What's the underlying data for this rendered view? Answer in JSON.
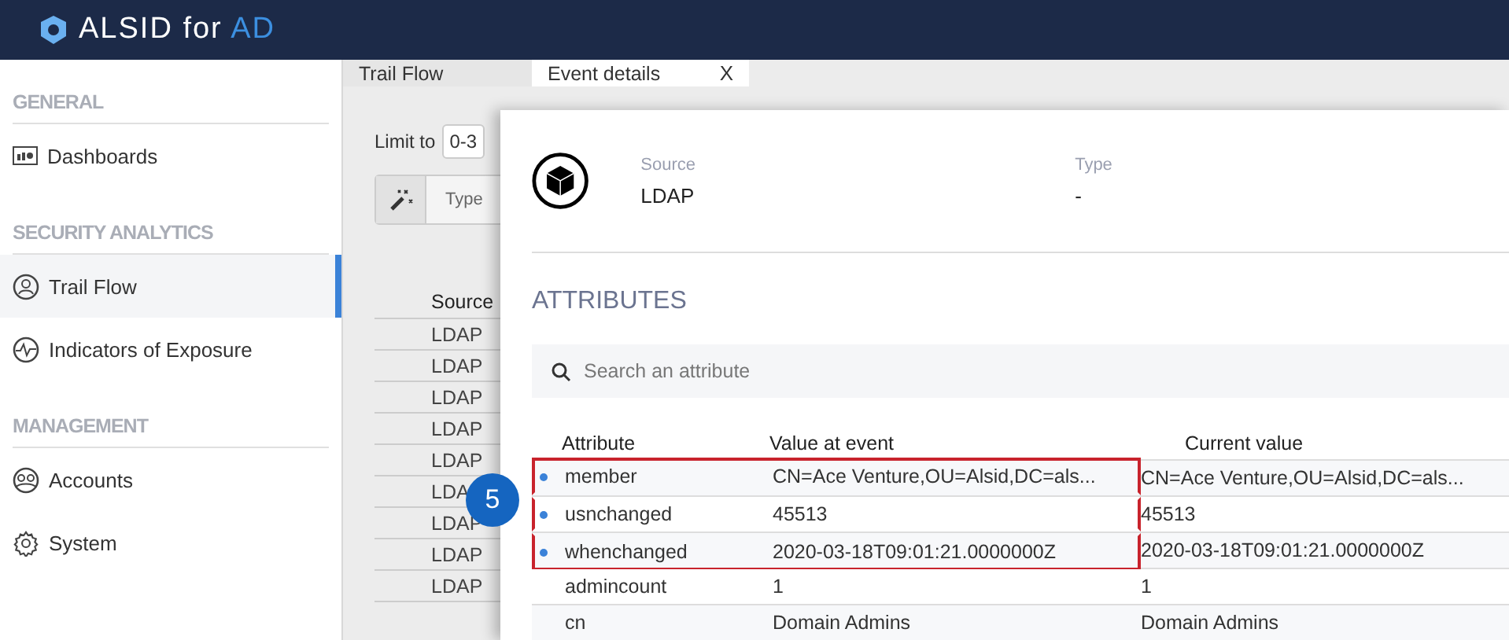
{
  "header": {
    "brand": "ALSID",
    "brand_suffix": "for",
    "brand_accent": "AD"
  },
  "sidebar": {
    "sections": [
      {
        "title": "GENERAL",
        "items": [
          {
            "label": "Dashboards",
            "selected": false
          }
        ]
      },
      {
        "title": "SECURITY ANALYTICS",
        "items": [
          {
            "label": "Trail Flow",
            "selected": true
          },
          {
            "label": "Indicators of Exposure",
            "selected": false
          }
        ]
      },
      {
        "title": "MANAGEMENT",
        "items": [
          {
            "label": "Accounts",
            "selected": false
          },
          {
            "label": "System",
            "selected": false
          }
        ]
      }
    ]
  },
  "tabs": [
    {
      "label": "Trail Flow",
      "selected": false
    },
    {
      "label": "Event details",
      "selected": true,
      "close_label": "X"
    }
  ],
  "trail_flow": {
    "limit_label": "Limit to",
    "limit_value": "0-3",
    "filter_label": "Type",
    "column": "Source",
    "rows": [
      "LDAP",
      "LDAP",
      "LDAP",
      "LDAP",
      "LDAP",
      "LDA",
      "LDAP",
      "LDAP",
      "LDAP"
    ]
  },
  "event_details": {
    "fields": [
      {
        "label": "Source",
        "value": "LDAP"
      },
      {
        "label": "Type",
        "value": "-"
      }
    ],
    "attributes_title": "ATTRIBUTES",
    "search": {
      "placeholder": "Search an attribute"
    },
    "columns": [
      "Attribute",
      "Value at event",
      "Current value"
    ],
    "rows": [
      {
        "attribute": "member",
        "value_at_event": "CN=Ace Venture,OU=Alsid,DC=als...",
        "current_value": "CN=Ace Venture,OU=Alsid,DC=als...",
        "changed": true,
        "highlighted": true
      },
      {
        "attribute": "usnchanged",
        "value_at_event": "45513",
        "current_value": "45513",
        "changed": true,
        "highlighted": true
      },
      {
        "attribute": "whenchanged",
        "value_at_event": "2020-03-18T09:01:21.0000000Z",
        "current_value": "2020-03-18T09:01:21.0000000Z",
        "changed": true,
        "highlighted": true
      },
      {
        "attribute": "admincount",
        "value_at_event": "1",
        "current_value": "1",
        "changed": false,
        "highlighted": false
      },
      {
        "attribute": "cn",
        "value_at_event": "Domain Admins",
        "current_value": "Domain Admins",
        "changed": false,
        "highlighted": false
      }
    ]
  },
  "callout": {
    "label": "5"
  }
}
